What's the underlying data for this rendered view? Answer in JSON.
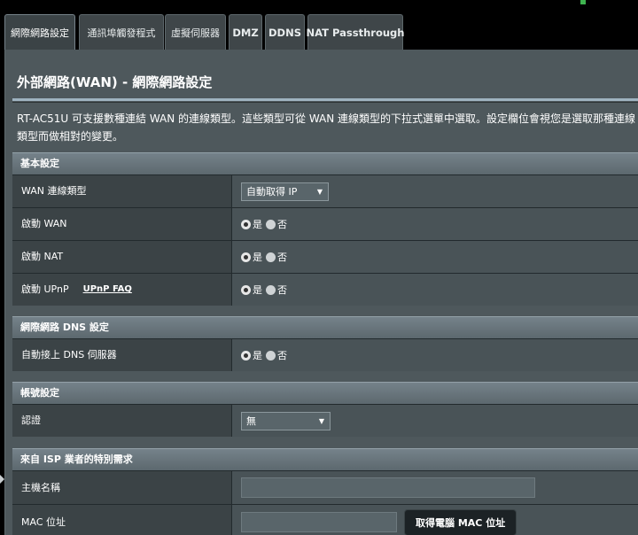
{
  "tabs": [
    {
      "label": "網際網路設定",
      "active": true
    },
    {
      "label": "通訊埠觸發程式"
    },
    {
      "label": "虛擬伺服器"
    },
    {
      "label": "DMZ"
    },
    {
      "label": "DDNS"
    },
    {
      "label": "NAT Passthrough"
    }
  ],
  "page": {
    "title": "外部網路(WAN) - 網際網路設定",
    "description": "RT-AC51U 可支援數種連結 WAN 的連線類型。這些類型可從 WAN 連線類型的下拉式選單中選取。設定欄位會視您是選取那種連線類型而做相對的變更。"
  },
  "radio": {
    "yes": "是",
    "no": "否"
  },
  "basic": {
    "header": "基本設定",
    "wan_type_label": "WAN 連線類型",
    "wan_type_value": "自動取得 IP",
    "enable_wan_label": "啟動 WAN",
    "enable_nat_label": "啟動 NAT",
    "enable_upnp_label": "啟動 UPnP",
    "upnp_faq": "UPnP FAQ"
  },
  "dns": {
    "header": "網際網路 DNS 設定",
    "auto_dns_label": "自動接上 DNS 伺服器"
  },
  "account": {
    "header": "帳號設定",
    "auth_label": "認證",
    "auth_value": "無"
  },
  "isp": {
    "header": "來自 ISP 業者的特別需求",
    "hostname_label": "主機名稱",
    "hostname_value": "",
    "mac_label": "MAC 位址",
    "mac_value": "",
    "clone_mac_button": "取得電腦 MAC 位址"
  }
}
